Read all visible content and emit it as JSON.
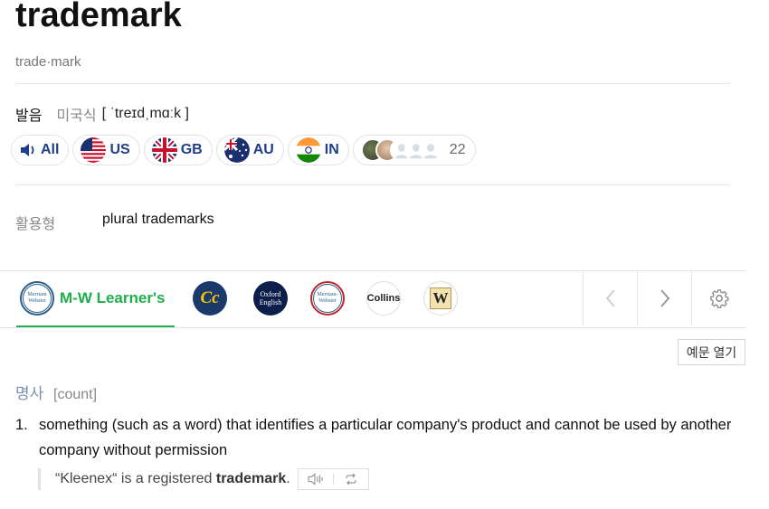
{
  "entry": {
    "word": "trademark",
    "syllables": "trade·mark"
  },
  "pronunciation": {
    "label": "발음",
    "region": "미국식",
    "ipa": "[ ˈtreɪdˌmɑːk ]",
    "buttons": [
      {
        "label": "All",
        "icon": "speaker-icon"
      },
      {
        "label": "US",
        "icon": "us-flag-icon"
      },
      {
        "label": "GB",
        "icon": "gb-flag-icon"
      },
      {
        "label": "AU",
        "icon": "au-flag-icon"
      },
      {
        "label": "IN",
        "icon": "in-flag-icon"
      }
    ],
    "contributors_count": "22"
  },
  "conjugation": {
    "label": "활용형",
    "value": "plural trademarks"
  },
  "dictionaries": {
    "active_label": "M-W Learner's",
    "logos": [
      {
        "name": "mw-learners",
        "text": "Merriam Webster"
      },
      {
        "name": "cambridge",
        "text": "Cc"
      },
      {
        "name": "oxford",
        "text": "Oxford English"
      },
      {
        "name": "merriam-webster",
        "text": "Merriam-Webster"
      },
      {
        "name": "collins",
        "text": "Collins"
      },
      {
        "name": "wordnet",
        "text": "W"
      }
    ],
    "colors": {
      "active": "#1fae4b"
    }
  },
  "example_toggle": "예문 열기",
  "sense": {
    "pos": "명사",
    "note": "[count]",
    "number": "1.",
    "definition": "something (such as a word) that identifies a particular company's product and cannot be used by another company without permission",
    "example_before": "“Kleenex“ is a registered ",
    "example_bold": "trademark",
    "example_after": "."
  }
}
